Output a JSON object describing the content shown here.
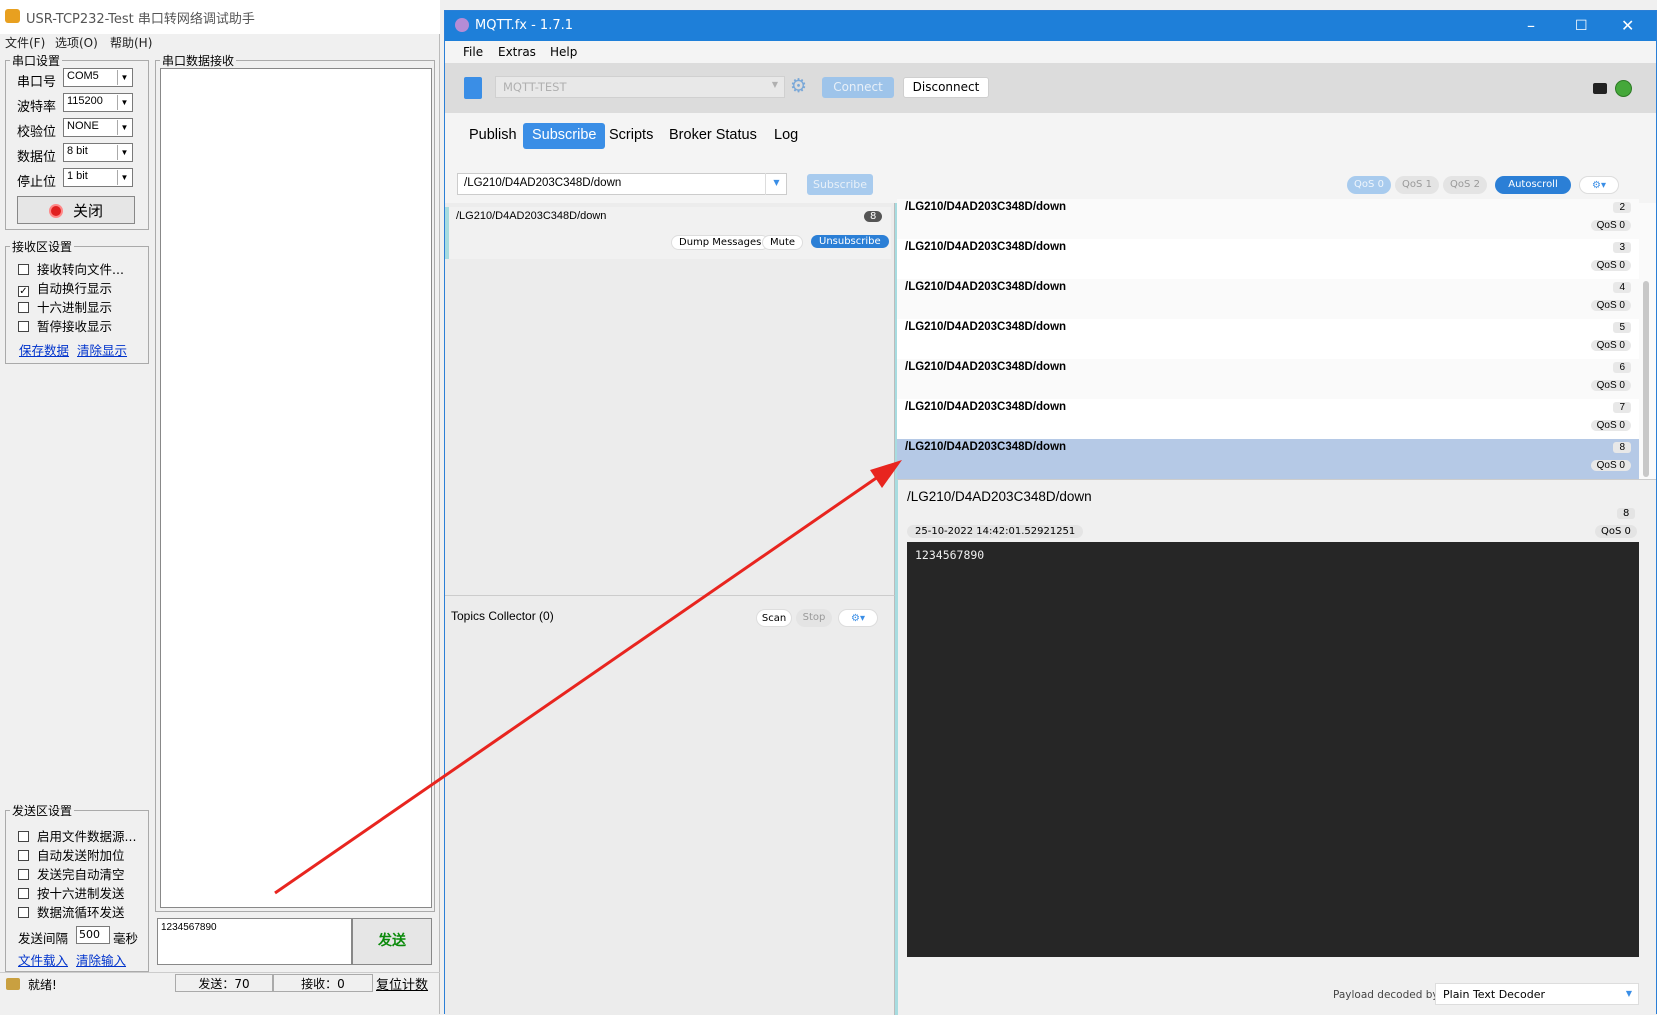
{
  "usr": {
    "title": "USR-TCP232-Test 串口转网络调试助手",
    "menu": [
      "文件(F)",
      "选项(O)",
      "帮助(H)"
    ],
    "serial_group": "串口设置",
    "fields": [
      {
        "label": "串口号",
        "value": "COM5"
      },
      {
        "label": "波特率",
        "value": "115200"
      },
      {
        "label": "校验位",
        "value": "NONE"
      },
      {
        "label": "数据位",
        "value": "8 bit"
      },
      {
        "label": "停止位",
        "value": "1 bit"
      }
    ],
    "close_button": "关闭",
    "recv_group": "接收区设置",
    "recv_options": [
      {
        "label": "接收转向文件...",
        "checked": false
      },
      {
        "label": "自动换行显示",
        "checked": true
      },
      {
        "label": "十六进制显示",
        "checked": false
      },
      {
        "label": "暂停接收显示",
        "checked": false
      }
    ],
    "save_data": "保存数据",
    "clear_display": "清除显示",
    "recv_area_title": "串口数据接收",
    "send_group": "发送区设置",
    "send_options": [
      {
        "label": "启用文件数据源...",
        "checked": false
      },
      {
        "label": "自动发送附加位",
        "checked": false
      },
      {
        "label": "发送完自动清空",
        "checked": false
      },
      {
        "label": "按十六进制发送",
        "checked": false
      },
      {
        "label": "数据流循环发送",
        "checked": false
      }
    ],
    "interval_label": "发送间隔",
    "interval_value": "500",
    "interval_unit": "毫秒",
    "file_load": "文件载入",
    "clear_input": "清除输入",
    "send_text": "1234567890",
    "send_button": "发送",
    "status": "就绪!",
    "sent": "发送：70",
    "received": "接收：0",
    "reset_count": "复位计数"
  },
  "mqtt": {
    "title": "MQTT.fx - 1.7.1",
    "menu": [
      "File",
      "Extras",
      "Help"
    ],
    "profile": "MQTT-TEST",
    "connect": "Connect",
    "disconnect": "Disconnect",
    "tabs": [
      "Publish",
      "Subscribe",
      "Scripts",
      "Broker Status",
      "Log"
    ],
    "active_tab": "Subscribe",
    "topic_input": "/LG210/D4AD203C348D/down",
    "subscribe_button": "Subscribe",
    "qos": [
      "QoS 0",
      "QoS 1",
      "QoS 2"
    ],
    "autoscroll": "Autoscroll",
    "subscription": {
      "topic": "/LG210/D4AD203C348D/down",
      "count": "8"
    },
    "dump_messages": "Dump Messages",
    "mute": "Mute",
    "unsubscribe": "Unsubscribe",
    "topics_collector": "Topics Collector (0)",
    "scan": "Scan",
    "stop": "Stop",
    "messages": [
      {
        "topic": "/LG210/D4AD203C348D/down",
        "num": "2",
        "qos": "QoS 0"
      },
      {
        "topic": "/LG210/D4AD203C348D/down",
        "num": "3",
        "qos": "QoS 0"
      },
      {
        "topic": "/LG210/D4AD203C348D/down",
        "num": "4",
        "qos": "QoS 0"
      },
      {
        "topic": "/LG210/D4AD203C348D/down",
        "num": "5",
        "qos": "QoS 0"
      },
      {
        "topic": "/LG210/D4AD203C348D/down",
        "num": "6",
        "qos": "QoS 0"
      },
      {
        "topic": "/LG210/D4AD203C348D/down",
        "num": "7",
        "qos": "QoS 0"
      },
      {
        "topic": "/LG210/D4AD203C348D/down",
        "num": "8",
        "qos": "QoS 0"
      }
    ],
    "detail": {
      "topic": "/LG210/D4AD203C348D/down",
      "num": "8",
      "timestamp": "25-10-2022  14:42:01.52921251",
      "qos": "QoS 0",
      "payload": "1234567890"
    },
    "payload_decoded_by": "Payload decoded by",
    "decoder": "Plain Text Decoder"
  },
  "colors": {
    "accent": "#1e7fd9",
    "selected_row": "#b5c9e6",
    "payload_bg": "#262626",
    "arrow": "#e8251f"
  }
}
